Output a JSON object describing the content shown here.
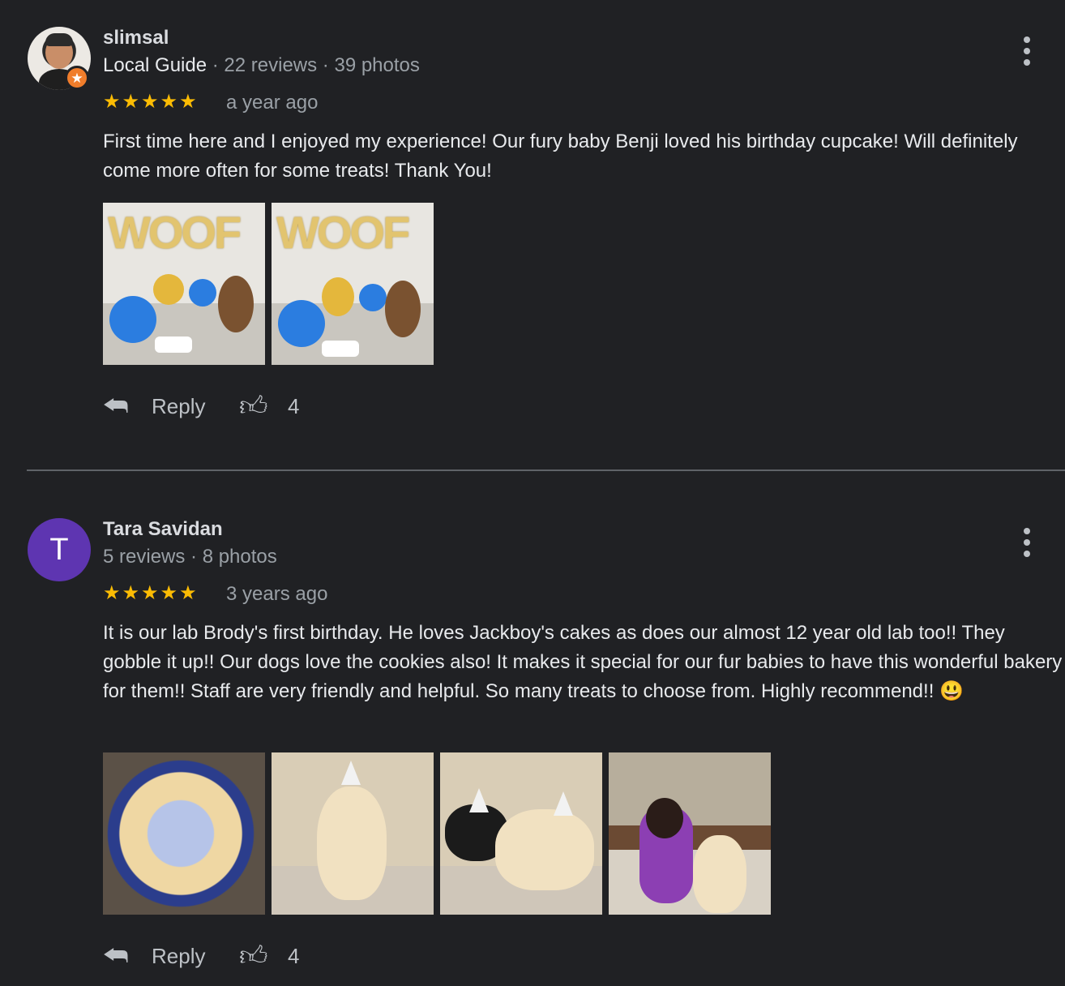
{
  "reviews": [
    {
      "name": "slimsal",
      "guide": "Local Guide",
      "meta": " · 22 reviews · 39 photos",
      "stars": "★★★★★",
      "date": "a year ago",
      "text": "First time here and I enjoyed my experience! Our fury baby Benji loved his birthday cupcake! Will definitely come more often for some treats! Thank You!",
      "photos": [
        "Woof balloons with Yorkie and birthday cupcake",
        "Woof balloons with Yorkie and birthday cupcake"
      ],
      "reply_label": "Reply",
      "likes": "4"
    },
    {
      "name": "Tara Savidan",
      "avatar_letter": "T",
      "meta": "5 reviews · 8 photos",
      "stars": "★★★★★",
      "date": "3 years ago",
      "text": "It is our lab Brody's first birthday.  He loves Jackboy's cakes as does our almost 12 year old lab too!!  They gobble it up!!  Our dogs love the cookies also!  It makes it special for our fur babies to have this wonderful bakery for them!!  Staff are very friendly and helpful.  So many treats to choose from.  Highly recommend!!  😃",
      "photos": [
        "Happy 1st Birthday Brody cake",
        "Yellow lab in party hat",
        "Black and yellow labs in party hats",
        "Woman with yellow lab and cake"
      ],
      "reply_label": "Reply",
      "likes": "4"
    }
  ],
  "icons": {
    "reply": "reply-arrow-icon",
    "like": "thumbs-up-icon",
    "menu": "more-vertical-icon",
    "badge": "local-guide-star-icon"
  },
  "colors": {
    "background": "#202124",
    "star": "#fbbc04",
    "avatar_purple": "#5e35b1",
    "guide_badge": "#f07d2b"
  }
}
